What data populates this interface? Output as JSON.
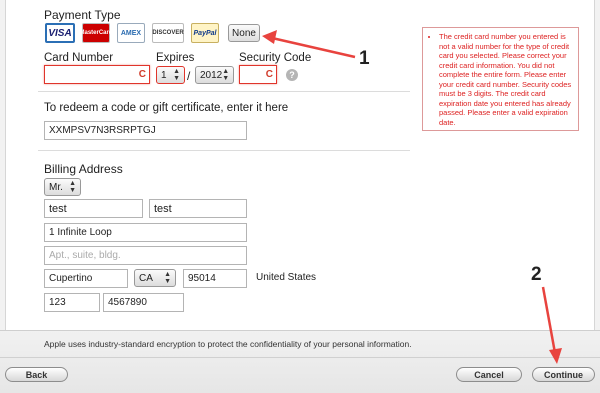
{
  "payment": {
    "heading": "Payment Type",
    "cards": [
      {
        "name": "visa",
        "label": "VISA"
      },
      {
        "name": "mastercard",
        "label": "MasterCard"
      },
      {
        "name": "amex",
        "label": "AMEX"
      },
      {
        "name": "discover",
        "label": "DISCOVER"
      },
      {
        "name": "paypal",
        "label": "PayPal"
      }
    ],
    "none_label": "None",
    "card_number_label": "Card Number",
    "expires_label": "Expires",
    "security_code_label": "Security Code",
    "card_number_value": "",
    "expires_month": "1",
    "expires_year": "2012",
    "security_code_value": "",
    "slash": "/",
    "help_glyph": "?"
  },
  "redeem": {
    "label": "To redeem a code or gift certificate, enter it here",
    "value": "XXMPSV7N3RSRPTGJ"
  },
  "billing": {
    "heading": "Billing Address",
    "title_value": "Mr.",
    "first_name": "test",
    "last_name": "test",
    "address1": "1 Infinite Loop",
    "address2_placeholder": "Apt., suite, bldg.",
    "city": "Cupertino",
    "state": "CA",
    "zip": "95014",
    "country": "United States",
    "area_code": "123",
    "phone": "4567890"
  },
  "error": {
    "message": "The credit card number you entered is not a valid number for the type of credit card you selected. Please correct your credit card information. You did not complete the entire form. Please enter your credit card number. Security codes must be 3 digits. The credit card expiration date you entered has already passed. Please enter a valid expiration date."
  },
  "footer": {
    "security_note": "Apple uses industry-standard encryption to protect the confidentiality of your personal information.",
    "back_label": "Back",
    "cancel_label": "Cancel",
    "continue_label": "Continue"
  },
  "annotations": {
    "marker_1": "1",
    "marker_2": "2",
    "arrow_color": "#e8433e"
  },
  "colors": {
    "error": "#e0352b",
    "error_text": "#d22222"
  }
}
